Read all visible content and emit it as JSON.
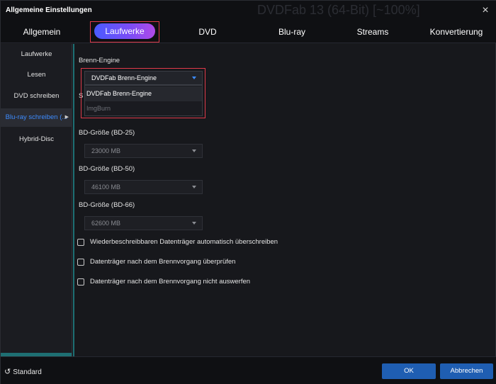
{
  "window": {
    "title": "Allgemeine Einstellungen",
    "background_title": "DVDFab 13 (64-Bit) [~100%]",
    "close_label": "×"
  },
  "tabs": [
    {
      "label": "Allgemein",
      "active": false
    },
    {
      "label": "Laufwerke",
      "active": true
    },
    {
      "label": "DVD",
      "active": false
    },
    {
      "label": "Blu-ray",
      "active": false
    },
    {
      "label": "Streams",
      "active": false
    },
    {
      "label": "Konvertierung",
      "active": false
    }
  ],
  "sidebar": {
    "items": [
      {
        "label": "Laufwerke",
        "active": false
      },
      {
        "label": "Lesen",
        "active": false
      },
      {
        "label": "DVD schreiben",
        "active": false
      },
      {
        "label": "Blu-ray schreiben (...",
        "active": true
      },
      {
        "label": "Hybrid-Disc",
        "active": false
      }
    ],
    "active_arrow": "▶"
  },
  "main": {
    "engine": {
      "label": "Brenn-Engine",
      "selected": "DVDFab Brenn-Engine",
      "options": [
        "DVDFab Brenn-Engine",
        "ImgBurn"
      ],
      "hidden_label_fragment": "S"
    },
    "bd25": {
      "label": "BD-Größe (BD-25)",
      "value": "23000 MB"
    },
    "bd50": {
      "label": "BD-Größe (BD-50)",
      "value": "46100 MB"
    },
    "bd66": {
      "label": "BD-Größe (BD-66)",
      "value": "62600 MB"
    },
    "checkboxes": [
      {
        "label": "Wiederbeschreibbaren Datenträger automatisch überschreiben",
        "checked": false
      },
      {
        "label": "Datenträger nach dem Brennvorgang überprüfen",
        "checked": false
      },
      {
        "label": "Datenträger nach dem Brennvorgang nicht auswerfen",
        "checked": false
      }
    ]
  },
  "footer": {
    "reset_icon": "↺",
    "reset_label": "Standard",
    "ok_label": "OK",
    "cancel_label": "Abbrechen"
  },
  "colors": {
    "accent_blue": "#3d8cff",
    "button_blue": "#1f5eb2",
    "highlight_red": "#e03a4a",
    "tab_gradient_start": "#4a5bff",
    "tab_gradient_end": "#b04ae8"
  }
}
